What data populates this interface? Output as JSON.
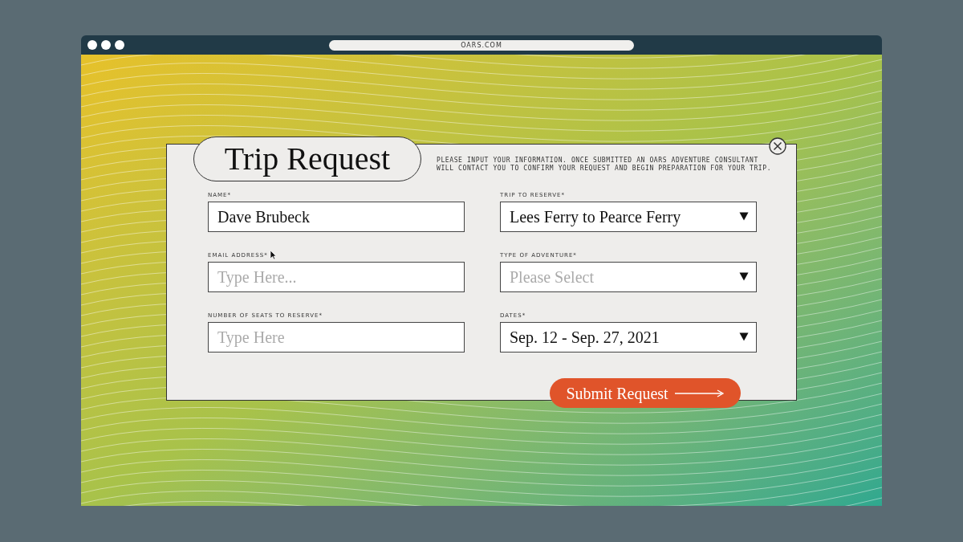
{
  "browser": {
    "address": "OARS.COM"
  },
  "form": {
    "title": "Trip Request",
    "description": "PLEASE INPUT YOUR INFORMATION. ONCE SUBMITTED AN OARS ADVENTURE CONSULTANT WILL CONTACT YOU TO CONFIRM YOUR REQUEST AND BEGIN PREPARATION FOR YOUR TRIP.",
    "fields": [
      {
        "kind": "text",
        "label": "NAME*",
        "value": "Dave Brubeck"
      },
      {
        "kind": "select",
        "label": "TRIP TO RESERVE*",
        "value": "Lees Ferry to Pearce Ferry"
      },
      {
        "kind": "text",
        "label": "EMAIL ADDRESS*",
        "placeholder": "Type Here..."
      },
      {
        "kind": "select",
        "label": "TYPE OF ADVENTURE*",
        "placeholder": "Please Select"
      },
      {
        "kind": "text",
        "label": "NUMBER OF SEATS TO RESERVE*",
        "placeholder": "Type Here"
      },
      {
        "kind": "select",
        "label": "DATES*",
        "value": "Sep. 12 - Sep. 27, 2021"
      }
    ],
    "submit": "Submit Request"
  }
}
